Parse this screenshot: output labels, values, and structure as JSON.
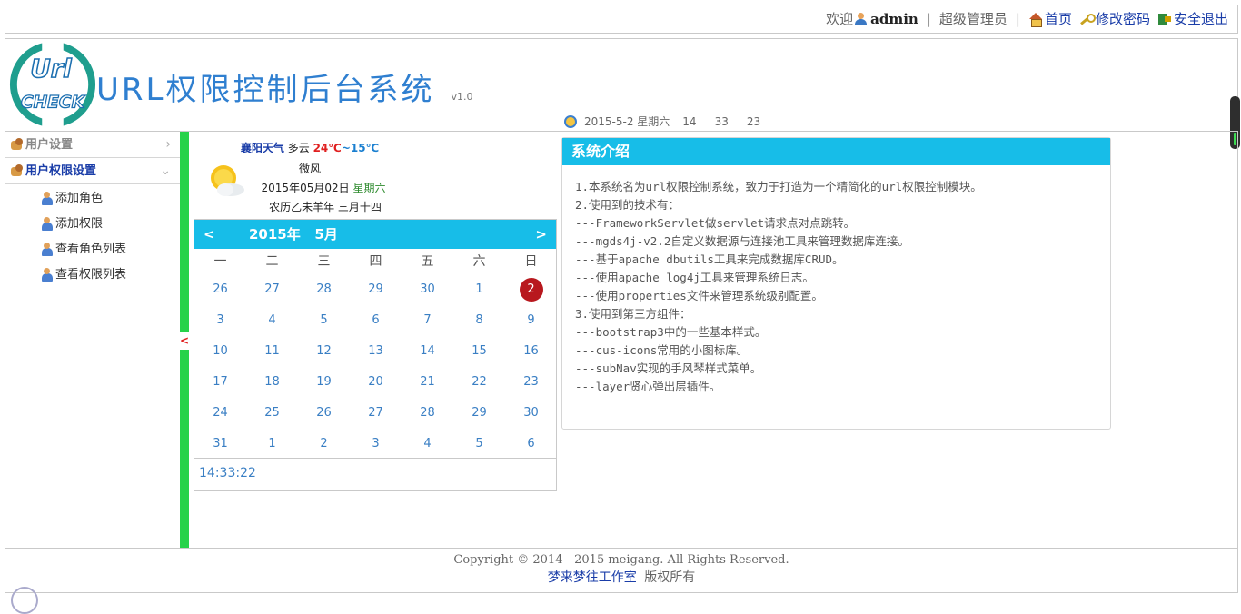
{
  "topbar": {
    "welcome": "欢迎",
    "username": "admin",
    "role": "超级管理员",
    "home": "首页",
    "change_password": "修改密码",
    "logout": "安全退出"
  },
  "header": {
    "logo_top": "Url",
    "logo_bottom": "CHECK",
    "title": "URL权限控制后台系统",
    "version": "v1.0",
    "date": "2015-5-2 星期六",
    "hh": "14",
    "mm": "33",
    "ss": "23"
  },
  "sidebar": {
    "groups": [
      {
        "label": "用户设置",
        "expanded": false
      },
      {
        "label": "用户权限设置",
        "expanded": true
      }
    ],
    "items": [
      "添加角色",
      "添加权限",
      "查看角色列表",
      "查看权限列表"
    ],
    "splitter_arrow": "<"
  },
  "weather": {
    "city": "襄阳天气",
    "condition": "多云",
    "high": "24℃",
    "tilde": "~",
    "low": "15℃",
    "wind": "微风",
    "date": "2015年05月02日",
    "weekday": "星期六",
    "lunar": "农历乙未羊年 三月十四"
  },
  "calendar": {
    "prev": "<",
    "next": ">",
    "title": "2015年   5月",
    "weekdays": [
      "一",
      "二",
      "三",
      "四",
      "五",
      "六",
      "日"
    ],
    "weeks": [
      [
        "26",
        "27",
        "28",
        "29",
        "30",
        "1",
        "2"
      ],
      [
        "3",
        "4",
        "5",
        "6",
        "7",
        "8",
        "9"
      ],
      [
        "10",
        "11",
        "12",
        "13",
        "14",
        "15",
        "16"
      ],
      [
        "17",
        "18",
        "19",
        "20",
        "21",
        "22",
        "23"
      ],
      [
        "24",
        "25",
        "26",
        "27",
        "28",
        "29",
        "30"
      ],
      [
        "31",
        "1",
        "2",
        "3",
        "4",
        "5",
        "6"
      ]
    ],
    "today": "2",
    "time": "14:33:22"
  },
  "intro": {
    "title": "系统介绍",
    "lines": [
      "1.本系统名为url权限控制系统，致力于打造为一个精简化的url权限控制模块。",
      "2.使用到的技术有：",
      "---FrameworkServlet做servlet请求点对点跳转。",
      "---mgds4j-v2.2自定义数据源与连接池工具来管理数据库连接。",
      "---基于apache dbutils工具来完成数据库CRUD。",
      "---使用apache log4j工具来管理系统日志。",
      "---使用properties文件来管理系统级别配置。",
      "3.使用到第三方组件：",
      "---bootstrap3中的一些基本样式。",
      "---cus-icons常用的小图标库。",
      "---subNav实现的手风琴样式菜单。",
      "---layer贤心弹出层插件。"
    ]
  },
  "footer": {
    "copyright": "Copyright © 2014 - 2015 meigang. All Rights Reserved.",
    "studio": "梦来梦往工作室",
    "rights": "版权所有"
  },
  "colors": {
    "accent": "#17bde8",
    "splitter": "#27d24a",
    "today": "#b8181e",
    "link": "#1a3da8"
  }
}
